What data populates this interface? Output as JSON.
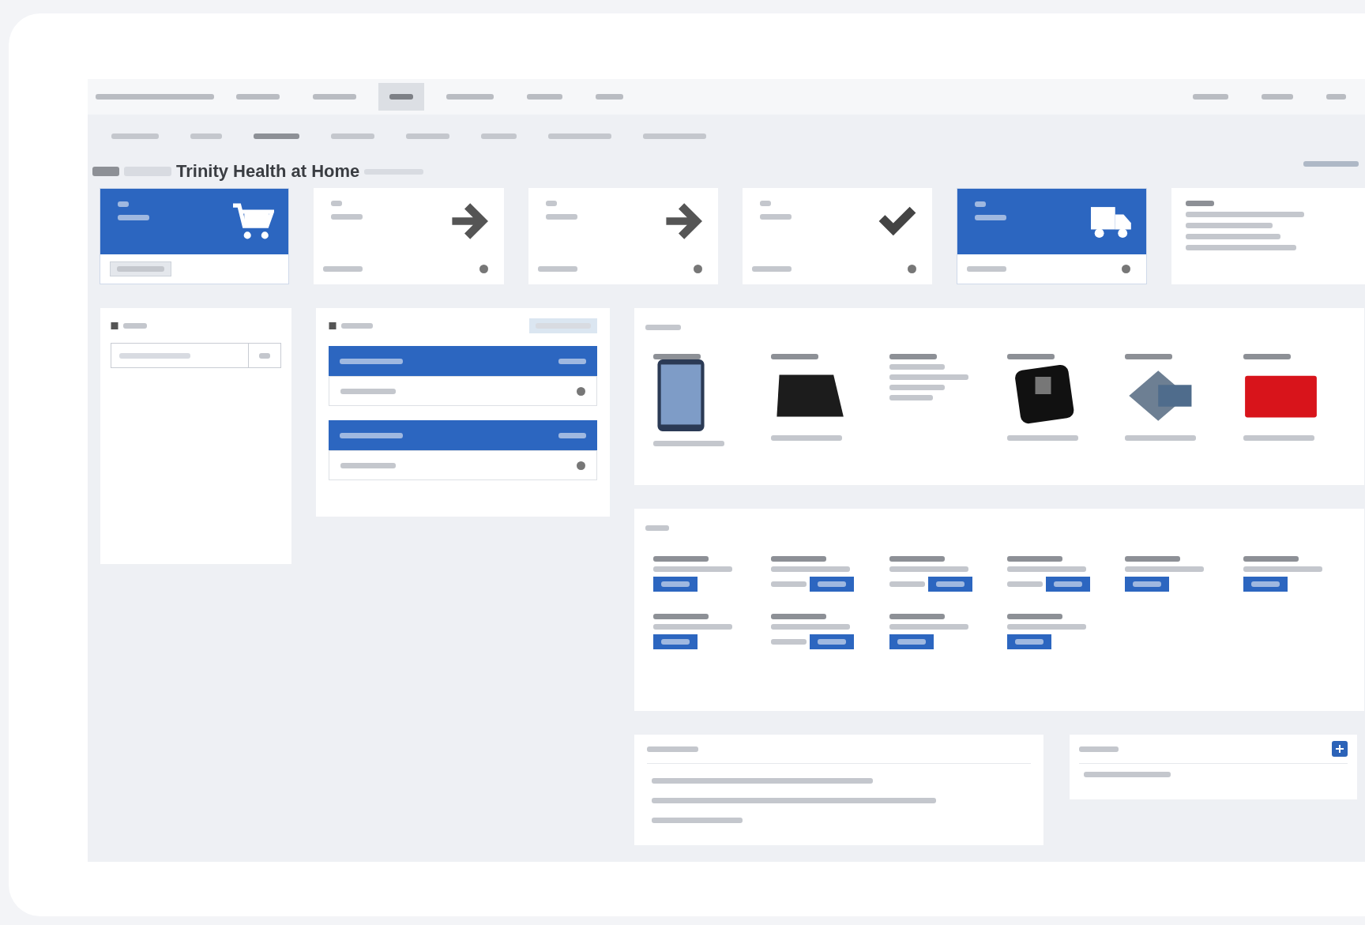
{
  "nav": {
    "items": [
      {
        "selected": false
      },
      {
        "selected": false
      },
      {
        "selected": true
      },
      {
        "selected": false
      },
      {
        "selected": false
      },
      {
        "selected": false
      }
    ],
    "right_items": [
      {
        "selected": false
      },
      {
        "selected": false
      },
      {
        "selected": false
      }
    ]
  },
  "subnav": {
    "items": [
      {
        "selected": false
      },
      {
        "selected": false
      },
      {
        "selected": true
      },
      {
        "selected": false
      },
      {
        "selected": false
      },
      {
        "selected": false
      },
      {
        "selected": false
      },
      {
        "selected": false
      }
    ]
  },
  "page_title": {
    "title": "Trinity Health at Home"
  },
  "steps": [
    {
      "kind": "cart",
      "active": true
    },
    {
      "kind": "arrow",
      "active": false
    },
    {
      "kind": "arrow",
      "active": false
    },
    {
      "kind": "check",
      "active": false
    },
    {
      "kind": "truck",
      "active": true
    }
  ],
  "devices": [
    {
      "kind": "phone"
    },
    {
      "kind": "scale"
    },
    {
      "kind": "text"
    },
    {
      "kind": "monitor"
    },
    {
      "kind": "meter"
    },
    {
      "kind": "card"
    }
  ],
  "kits": [
    {
      "kind": "below"
    },
    {
      "kind": "inline"
    },
    {
      "kind": "inline"
    },
    {
      "kind": "inline"
    },
    {
      "kind": "below"
    },
    {
      "kind": "below"
    },
    {
      "kind": "below"
    },
    {
      "kind": "inline"
    },
    {
      "kind": "below"
    },
    {
      "kind": "below"
    }
  ]
}
